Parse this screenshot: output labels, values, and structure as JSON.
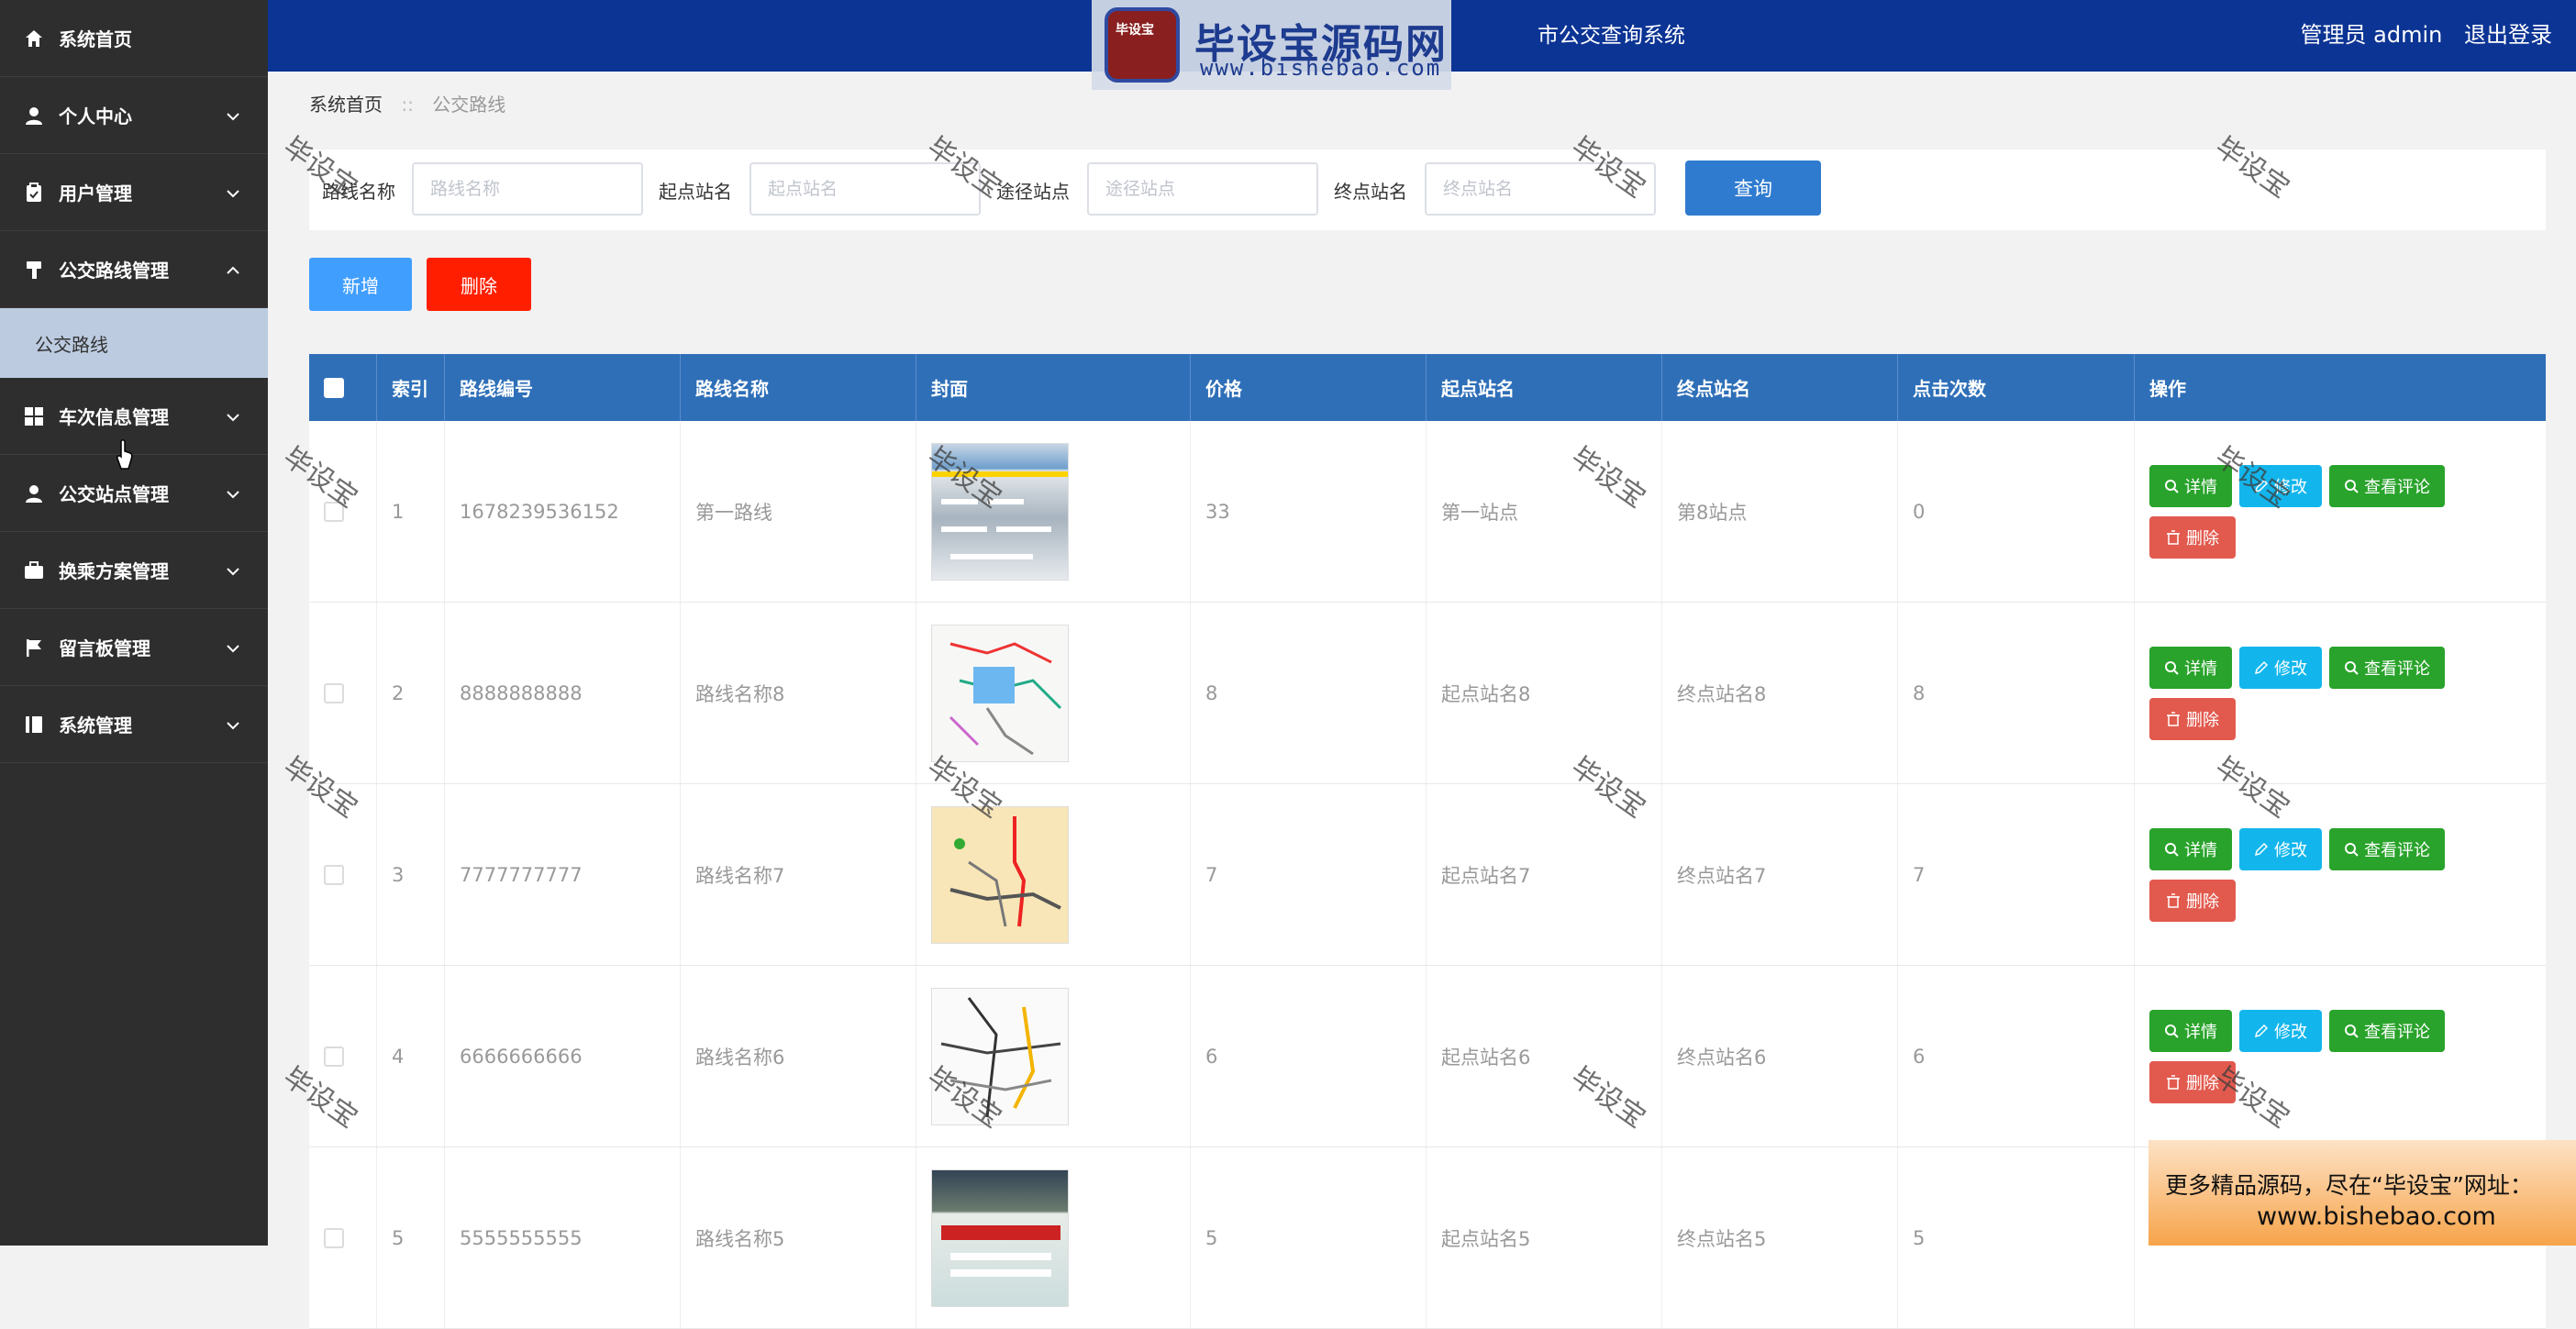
{
  "sidebar": {
    "items": [
      {
        "label": "系统首页",
        "icon": "home-icon",
        "chevron": ""
      },
      {
        "label": "个人中心",
        "icon": "user-icon",
        "chevron": "down"
      },
      {
        "label": "用户管理",
        "icon": "clipboard-icon",
        "chevron": "down"
      },
      {
        "label": "公交路线管理",
        "icon": "paint-roller-icon",
        "chevron": "up"
      },
      {
        "label": "车次信息管理",
        "icon": "grid-icon",
        "chevron": "down"
      },
      {
        "label": "公交站点管理",
        "icon": "user-icon",
        "chevron": "down"
      },
      {
        "label": "换乘方案管理",
        "icon": "briefcase-icon",
        "chevron": "down"
      },
      {
        "label": "留言板管理",
        "icon": "flag-icon",
        "chevron": "down"
      },
      {
        "label": "系统管理",
        "icon": "book-icon",
        "chevron": "down"
      }
    ],
    "active_sub": "公交路线"
  },
  "header": {
    "title": "市公交查询系统",
    "admin": "管理员 admin",
    "logout": "退出登录",
    "logo_badge": "毕设宝",
    "logo_text": "毕设宝源码网",
    "logo_url": "www.bishebao.com"
  },
  "breadcrumb": {
    "home": "系统首页",
    "sep": "::",
    "current": "公交路线"
  },
  "search": {
    "route_name_label": "路线名称",
    "route_name_placeholder": "路线名称",
    "start_label": "起点站名",
    "start_placeholder": "起点站名",
    "via_label": "途径站点",
    "via_placeholder": "途径站点",
    "end_label": "终点站名",
    "end_placeholder": "终点站名",
    "query_button": "查询"
  },
  "actions": {
    "add": "新增",
    "delete": "删除"
  },
  "table": {
    "headers": [
      "",
      "索引",
      "路线编号",
      "路线名称",
      "封面",
      "价格",
      "起点站名",
      "终点站名",
      "点击次数",
      "操作"
    ],
    "rows": [
      {
        "index": "1",
        "code": "1678239536152",
        "name": "第一路线",
        "price": "33",
        "start": "第一站点",
        "end": "第8站点",
        "clicks": "0"
      },
      {
        "index": "2",
        "code": "8888888888",
        "name": "路线名称8",
        "price": "8",
        "start": "起点站名8",
        "end": "终点站名8",
        "clicks": "8"
      },
      {
        "index": "3",
        "code": "7777777777",
        "name": "路线名称7",
        "price": "7",
        "start": "起点站名7",
        "end": "终点站名7",
        "clicks": "7"
      },
      {
        "index": "4",
        "code": "6666666666",
        "name": "路线名称6",
        "price": "6",
        "start": "起点站名6",
        "end": "终点站名6",
        "clicks": "6"
      },
      {
        "index": "5",
        "code": "5555555555",
        "name": "路线名称5",
        "price": "5",
        "start": "起点站名5",
        "end": "终点站名5",
        "clicks": "5"
      }
    ],
    "op_labels": {
      "detail": "详情",
      "edit": "修改",
      "comment": "查看评论",
      "delete": "删除"
    }
  },
  "watermark": "毕设宝",
  "promo": {
    "line1": "更多精品源码，尽在“毕设宝”网址：",
    "line2": "www.bishebao.com"
  },
  "colors": {
    "sidebar": "#2e2e2e",
    "topbar": "#0c3494",
    "table_header": "#2e6fb8",
    "add": "#409eff",
    "delete": "#ff1f00",
    "detail": "#29a32b",
    "edit": "#13b6ec",
    "row_delete": "#e25a4e"
  }
}
